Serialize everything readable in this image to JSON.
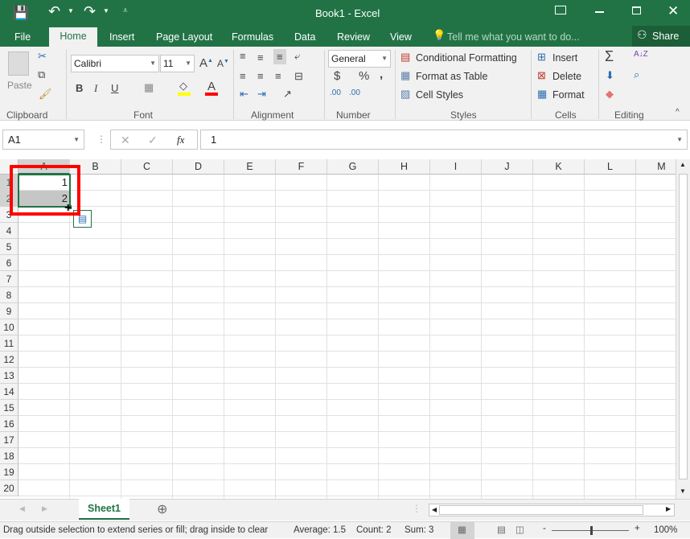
{
  "title": "Book1 - Excel",
  "qat": {
    "save": "save-icon",
    "undo": "undo-icon",
    "redo": "redo-icon"
  },
  "tabs": [
    "File",
    "Home",
    "Insert",
    "Page Layout",
    "Formulas",
    "Data",
    "Review",
    "View"
  ],
  "tell_me": "Tell me what you want to do...",
  "share": "Share",
  "ribbon": {
    "clipboard": {
      "label": "Clipboard",
      "paste": "Paste"
    },
    "font": {
      "label": "Font",
      "name": "Calibri",
      "size": "11",
      "bold": "B",
      "italic": "I",
      "underline": "U",
      "font_color": "A",
      "fill_color": "#ffff00",
      "text_color": "#ff0000"
    },
    "alignment": {
      "label": "Alignment"
    },
    "number": {
      "label": "Number",
      "format": "General",
      "currency": "$",
      "percent": "%",
      "comma": ",",
      "inc_dec": ".00"
    },
    "styles": {
      "label": "Styles",
      "conditional": "Conditional Formatting",
      "format_table": "Format as Table",
      "cell_styles": "Cell Styles"
    },
    "cells": {
      "label": "Cells",
      "insert": "Insert",
      "delete": "Delete",
      "format": "Format"
    },
    "editing": {
      "label": "Editing",
      "sum": "Σ"
    }
  },
  "formula_bar": {
    "name_box": "A1",
    "fx": "fx",
    "value": "1",
    "cancel": "✕",
    "enter": "✓"
  },
  "columns": [
    "A",
    "B",
    "C",
    "D",
    "E",
    "F",
    "G",
    "H",
    "I",
    "J",
    "K",
    "L",
    "M"
  ],
  "rows": [
    "1",
    "2",
    "3",
    "4",
    "5",
    "6",
    "7",
    "8",
    "9",
    "10",
    "11",
    "12",
    "13",
    "14",
    "15",
    "16",
    "17",
    "18",
    "19",
    "20"
  ],
  "cells": {
    "A1": "1",
    "A2": "2"
  },
  "sheets": [
    "Sheet1"
  ],
  "status": {
    "message": "Drag outside selection to extend series or fill; drag inside to clear",
    "average": "Average: 1.5",
    "count": "Count: 2",
    "sum": "Sum: 3",
    "zoom": "100%"
  },
  "colors": {
    "brand": "#217346",
    "highlight": "#ff0000"
  }
}
